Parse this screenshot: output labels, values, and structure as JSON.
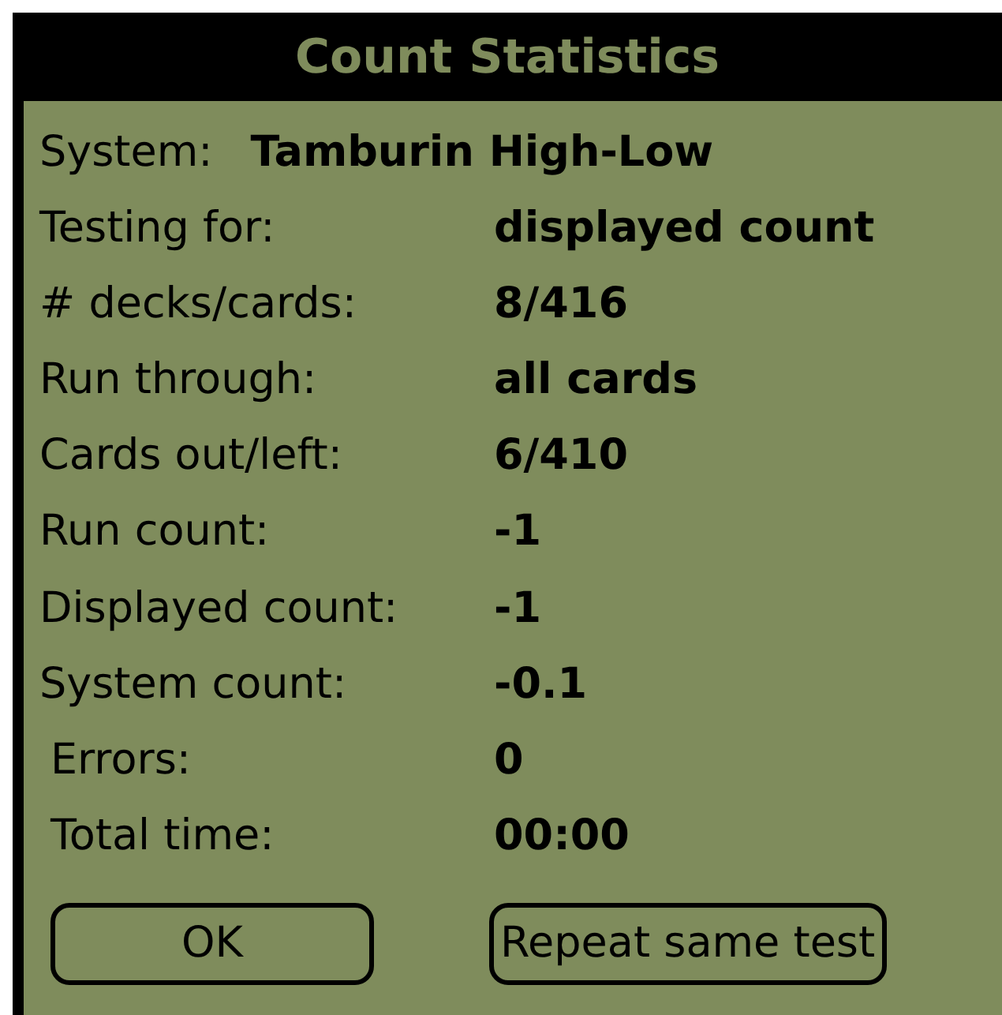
{
  "window": {
    "title": "Count Statistics"
  },
  "system": {
    "label": "System:",
    "value": "Tamburin High-Low"
  },
  "rows": [
    {
      "label": "Testing for:",
      "value": "displayed count",
      "indented": false
    },
    {
      "label": "# decks/cards:",
      "value": "8/416",
      "indented": false
    },
    {
      "label": "Run through:",
      "value": "all cards",
      "indented": false
    },
    {
      "label": "Cards out/left:",
      "value": "6/410",
      "indented": false
    },
    {
      "label": "Run count:",
      "value": "-1",
      "indented": false
    },
    {
      "label": "Displayed count:",
      "value": "-1",
      "indented": false
    },
    {
      "label": "System count:",
      "value": "-0.1",
      "indented": false
    },
    {
      "label": "Errors:",
      "value": "0",
      "indented": true
    },
    {
      "label": "Total time:",
      "value": "00:00",
      "indented": true
    }
  ],
  "buttons": [
    "OK",
    "Repeat same test"
  ]
}
